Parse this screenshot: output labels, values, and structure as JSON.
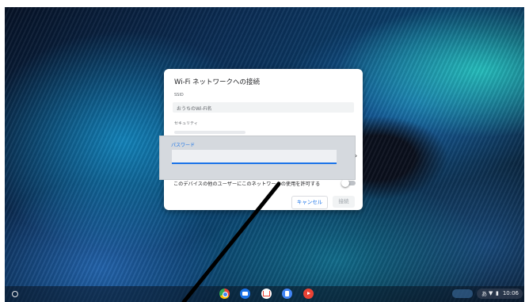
{
  "dialog": {
    "title": "Wi-Fi ネットワークへの接続",
    "ssid_label": "SSID",
    "ssid_value": "おうちのWi-Fi名",
    "security_label": "セキュリティ",
    "password_label": "パスワード",
    "share_text": "このデバイスの他のユーザーにこのネットワークの使用を許可する",
    "share_enabled": false,
    "cancel_label": "キャンセル",
    "connect_label": "接続"
  },
  "shelf": {
    "apps": [
      "chrome-icon",
      "files-icon",
      "gmail-icon",
      "docs-icon",
      "youtube-icon"
    ],
    "tray": {
      "ime": "あ",
      "time": "10:06"
    }
  },
  "colors": {
    "accent": "#1a73e8"
  }
}
